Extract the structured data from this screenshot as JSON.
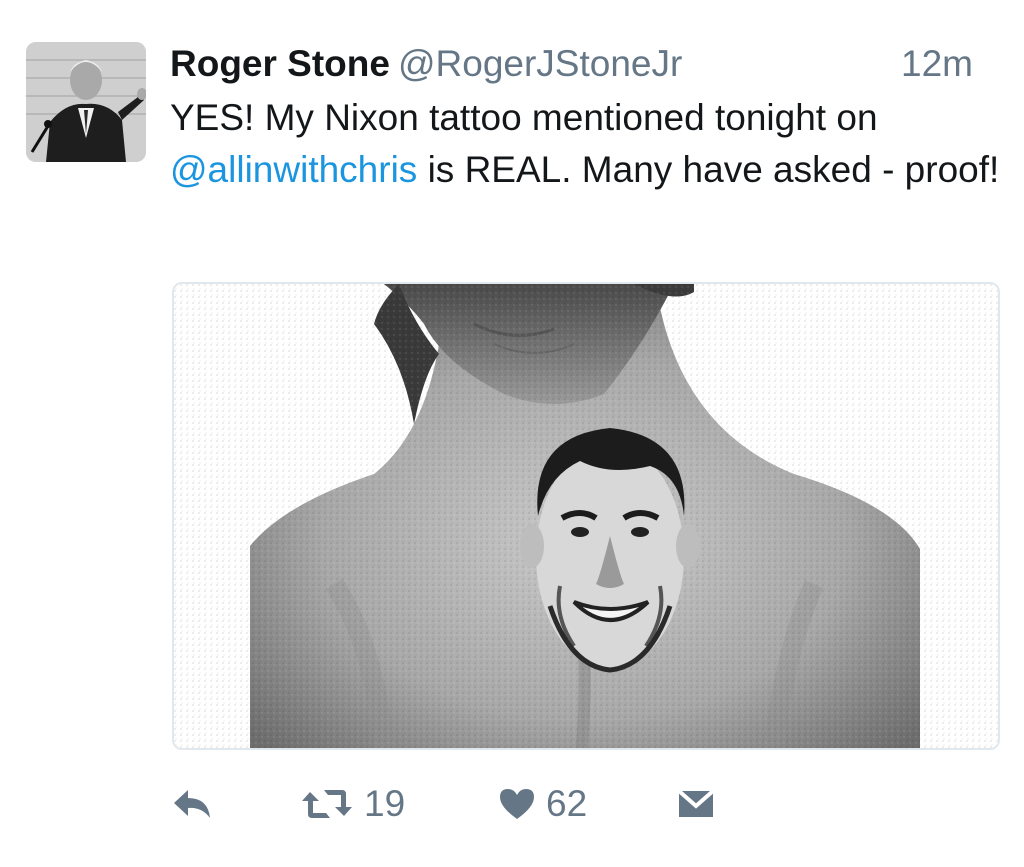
{
  "tweet": {
    "name": "Roger Stone",
    "handle": "@RogerJStoneJr",
    "time": "12m",
    "text_part1": "YES! My Nixon tattoo mentioned tonight on ",
    "mention": "@allinwithchris",
    "text_part2": " is REAL. Many have asked - proof!",
    "media_alt": "Photo of a man's back with a tattoo of Richard Nixon's face"
  },
  "actions": {
    "reply_icon": "reply-icon",
    "retweet_icon": "retweet-icon",
    "retweet_count": "19",
    "like_icon": "heart-icon",
    "like_count": "62",
    "dm_icon": "direct-message-icon"
  },
  "colors": {
    "mention": "#1b95e0",
    "secondary_text": "#657786",
    "media_border": "#e1e8ed"
  }
}
